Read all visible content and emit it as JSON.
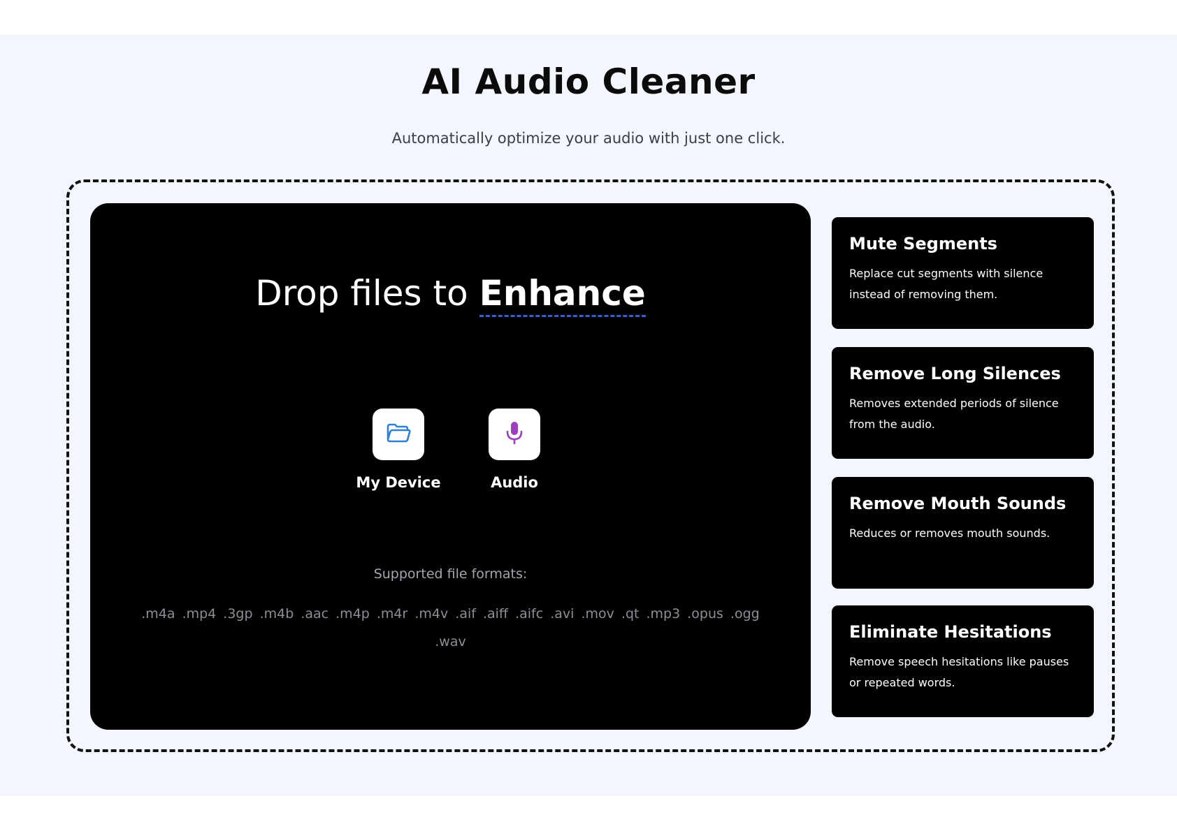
{
  "header": {
    "title": "AI Audio Cleaner",
    "subtitle": "Automatically optimize your audio with just one click."
  },
  "dropzone": {
    "heading_prefix": "Drop files to",
    "heading_accent": "Enhance",
    "sources": [
      {
        "label": "My Device",
        "icon": "folder-icon",
        "color": "#2f7fd6"
      },
      {
        "label": "Audio",
        "icon": "microphone-icon",
        "color": "#9b3fbf"
      }
    ],
    "formats_label": "Supported file formats:",
    "formats": ".m4a .mp4 .3gp .m4b .aac .m4p .m4r .m4v .aif .aiff .aifc .avi .mov .qt .mp3 .opus .ogg .wav"
  },
  "features": [
    {
      "title": "Mute Segments",
      "description": "Replace cut segments with silence instead of removing them."
    },
    {
      "title": "Remove Long Silences",
      "description": "Removes extended periods of silence from the audio."
    },
    {
      "title": "Remove Mouth Sounds",
      "description": "Reduces or removes mouth sounds."
    },
    {
      "title": "Eliminate Hesitations",
      "description": "Remove speech hesitations like pauses or repeated words."
    }
  ],
  "colors": {
    "background": "#f3f6fc",
    "card": "#000000",
    "accent_underline": "#3b5fd1"
  }
}
